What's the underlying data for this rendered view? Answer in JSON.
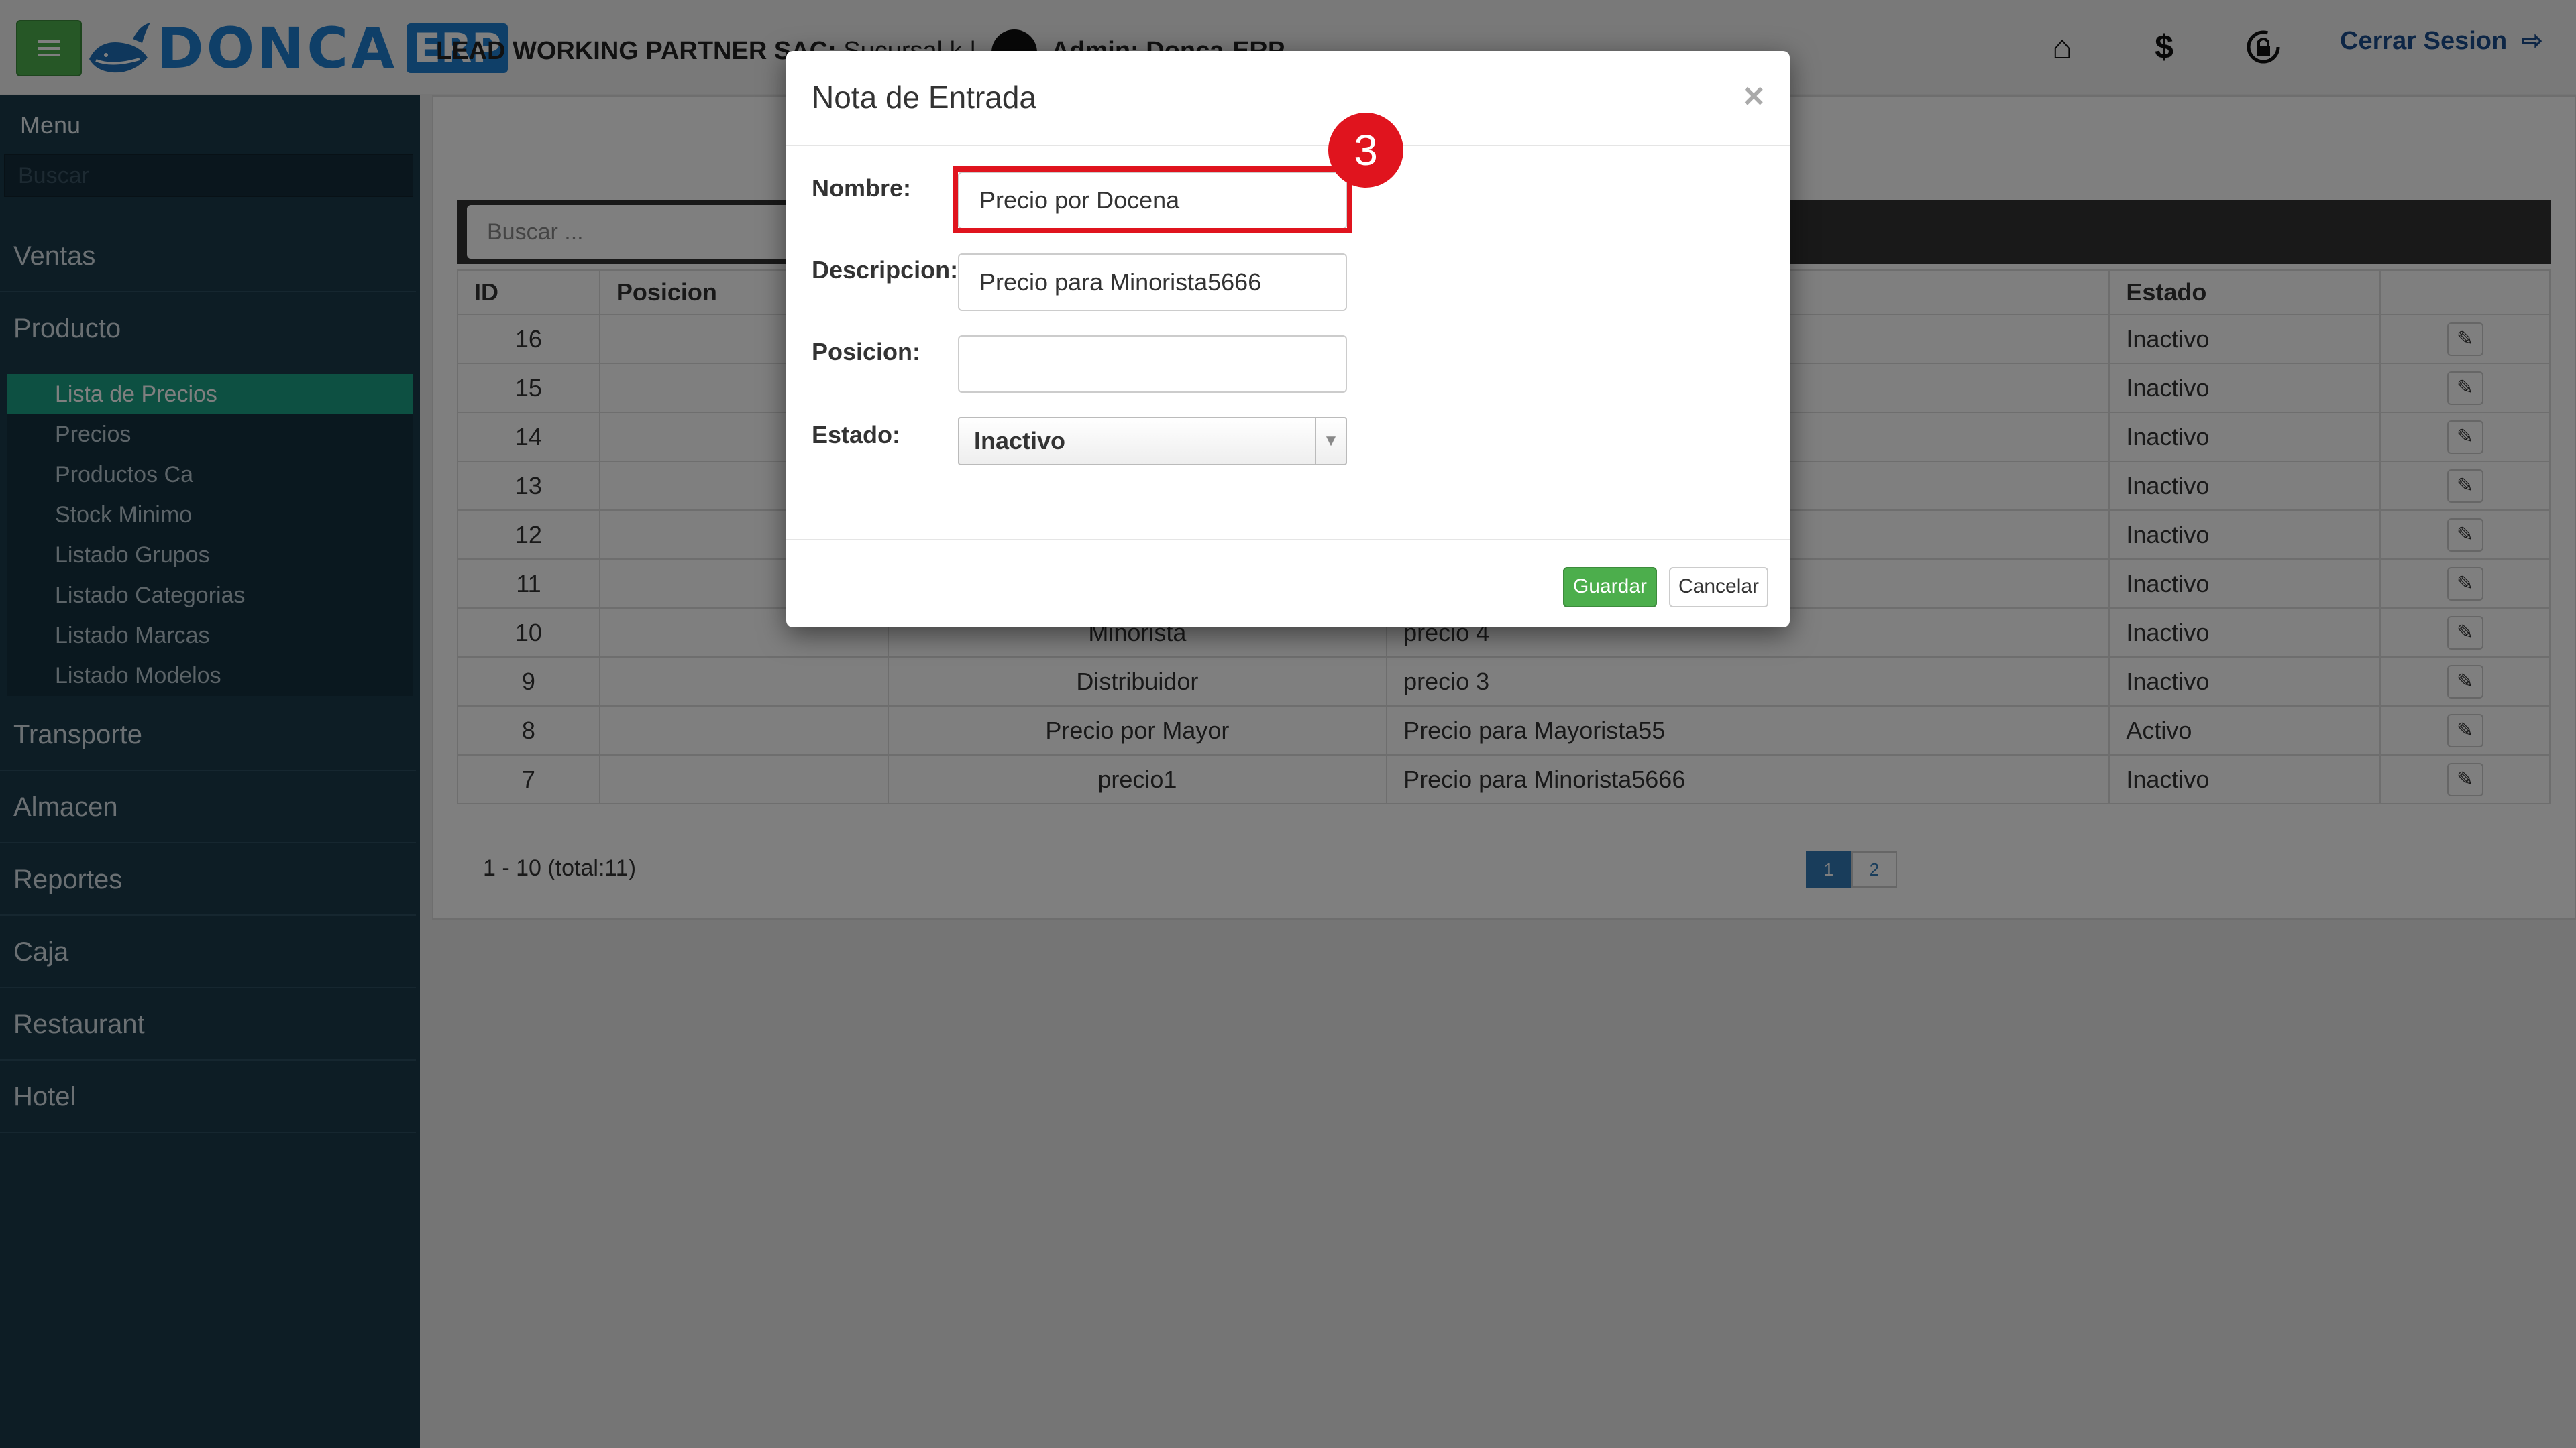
{
  "header": {
    "brand": "DONCA",
    "brand_suffix": "ERP",
    "company": "LEAD WORKING PARTNER SAC:",
    "branch": "Sucursal k |",
    "admin": "Admin: Donca-ERP",
    "logout": "Cerrar Sesion",
    "icons": [
      "home-icon",
      "dollar-icon",
      "lock-refresh-icon",
      "logout-icon"
    ]
  },
  "sidebar": {
    "title": "Menu",
    "search_placeholder": "Buscar",
    "sections": [
      "Ventas",
      "Producto",
      "Transporte",
      "Almacen",
      "Reportes",
      "Caja",
      "Restaurant",
      "Hotel"
    ],
    "sub_items": [
      "Lista de Precios",
      "Precios",
      "Productos Ca",
      "Stock Minimo",
      "Listado Grupos",
      "Listado Categorias",
      "Listado Marcas",
      "Listado Modelos"
    ],
    "active_sub_item": "Lista de Precios"
  },
  "table": {
    "search_placeholder": "Buscar ...",
    "columns": [
      "ID",
      "Posicion",
      "",
      "",
      "Estado",
      ""
    ],
    "rows": [
      {
        "id": "16",
        "nombre": "",
        "descripcion": "",
        "estado": "Inactivo"
      },
      {
        "id": "15",
        "nombre": "",
        "descripcion": "",
        "estado": "Inactivo"
      },
      {
        "id": "14",
        "nombre": "",
        "descripcion": "",
        "estado": "Inactivo"
      },
      {
        "id": "13",
        "nombre": "",
        "descripcion": "",
        "estado": "Inactivo"
      },
      {
        "id": "12",
        "nombre": "",
        "descripcion": "",
        "estado": "Inactivo"
      },
      {
        "id": "11",
        "nombre": "",
        "descripcion": "",
        "estado": "Inactivo"
      },
      {
        "id": "10",
        "nombre": "Minorista",
        "descripcion": "precio 4",
        "estado": "Inactivo"
      },
      {
        "id": "9",
        "nombre": "Distribuidor",
        "descripcion": "precio 3",
        "estado": "Inactivo"
      },
      {
        "id": "8",
        "nombre": "Precio por Mayor",
        "descripcion": "Precio para Mayorista55",
        "estado": "Activo"
      },
      {
        "id": "7",
        "nombre": "precio1",
        "descripcion": "Precio para Minorista5666",
        "estado": "Inactivo"
      }
    ],
    "pagination_info": "1 - 10 (total:11)",
    "pages": [
      "1",
      "2"
    ],
    "current_page": "1"
  },
  "modal": {
    "title": "Nota de Entrada",
    "close": "×",
    "fields": {
      "nombre_label": "Nombre:",
      "nombre_value": "Precio por Docena",
      "descripcion_label": "Descripcion:",
      "descripcion_value": "Precio para Minorista5666",
      "posicion_label": "Posicion:",
      "posicion_value": "",
      "estado_label": "Estado:",
      "estado_value": "Inactivo"
    },
    "save": "Guardar",
    "cancel": "Cancelar"
  },
  "annotation": {
    "step": "3",
    "color": "#e0141e"
  }
}
